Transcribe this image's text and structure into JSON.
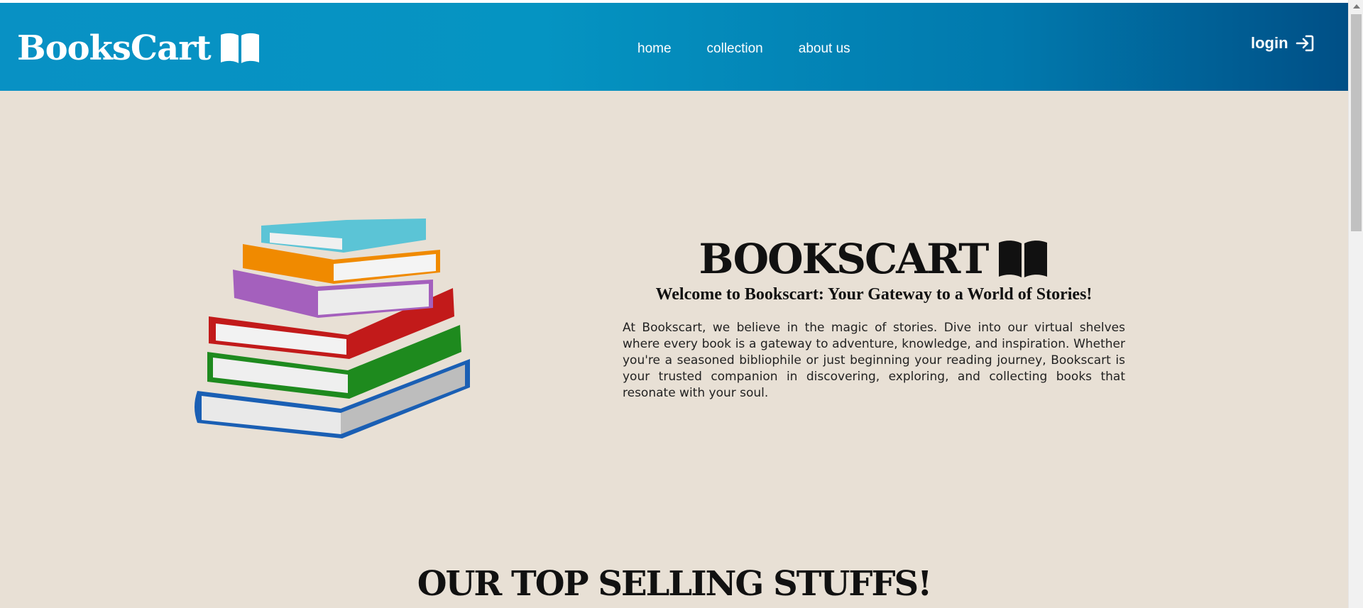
{
  "header": {
    "brand": "BooksCart",
    "brand_icon": "open-book-icon",
    "nav": [
      "home",
      "collection",
      "about us"
    ],
    "login_label": "login",
    "login_icon": "sign-in-icon",
    "gradient_start": "#0891c4",
    "gradient_end": "#004f86"
  },
  "hero": {
    "image_icon": "book-stack-illustration",
    "title": "BOOKSCART",
    "title_icon": "open-book-icon",
    "subtitle": "Welcome to Bookscart: Your Gateway to a World of Stories!",
    "body": "At Bookscart, we believe in the magic of stories. Dive into our virtual shelves where every book is a gateway to adventure, knowledge, and inspiration. Whether you're a seasoned bibliophile or just beginning your reading journey, Bookscart is your trusted companion in discovering, exploring, and collecting books that resonate with your soul."
  },
  "top_selling": {
    "heading": "OUR TOP SELLING STUFFS!"
  },
  "colors": {
    "page_background": "#e8e0d5",
    "text": "#111111"
  }
}
